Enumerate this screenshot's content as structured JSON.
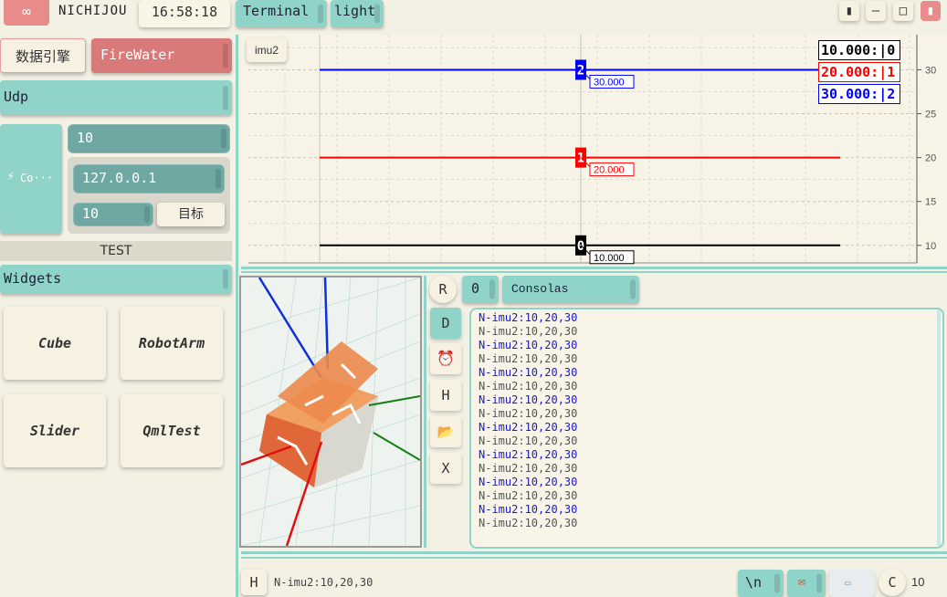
{
  "app": {
    "logo_symbol": "∞",
    "title": "NICHIJOU",
    "clock": "16:58:18",
    "tab_terminal": "Terminal",
    "tab_theme": "light",
    "window_controls": {
      "pin": "▮",
      "minimize": "–",
      "maximize": "□",
      "close": "▮"
    }
  },
  "left": {
    "engine_label": "数据引擎",
    "engine_value": "FireWater",
    "protocol": "Udp",
    "connect_label": "Co···",
    "interval": "10",
    "ip": "127.0.0.1",
    "port": "10",
    "target_label": "目标",
    "test_label": "TEST",
    "widgets_label": "Widgets",
    "tiles": [
      "Cube",
      "RobotArm",
      "Slider",
      "QmlTest"
    ]
  },
  "plot": {
    "tag": "imu2",
    "legend": [
      {
        "text": "10.000:|0",
        "color": "#000000"
      },
      {
        "text": "20.000:|1",
        "color": "#ff0000"
      },
      {
        "text": "30.000:|2",
        "color": "#0000ff"
      }
    ],
    "chart_data": {
      "type": "line",
      "x": [
        0,
        1
      ],
      "series": [
        {
          "values": [
            10,
            10
          ],
          "color": "#000000",
          "marker": "0",
          "label": "10.000"
        },
        {
          "values": [
            20,
            20
          ],
          "color": "#ff0000",
          "marker": "1",
          "label": "20.000"
        },
        {
          "values": [
            30,
            30
          ],
          "color": "#0000ff",
          "marker": "2",
          "label": "30.000"
        }
      ],
      "ylim": [
        8,
        34
      ],
      "yticks": [
        10,
        15,
        20,
        25,
        30
      ],
      "grid": true
    }
  },
  "terminal": {
    "btn_r": "R",
    "btn_d": "D",
    "btn_h": "H",
    "btn_x": "X",
    "mode_value": "0",
    "font_value": "Consolas",
    "lines": [
      {
        "text": "N-imu2:10,20,30",
        "color": "#1a1acc"
      },
      {
        "text": "N-imu2:10,20,30",
        "color": "#555555"
      },
      {
        "text": "N-imu2:10,20,30",
        "color": "#1a1acc"
      },
      {
        "text": "N-imu2:10,20,30",
        "color": "#555555"
      },
      {
        "text": "N-imu2:10,20,30",
        "color": "#1a1acc"
      },
      {
        "text": "N-imu2:10,20,30",
        "color": "#555555"
      },
      {
        "text": "N-imu2:10,20,30",
        "color": "#1a1acc"
      },
      {
        "text": "N-imu2:10,20,30",
        "color": "#555555"
      },
      {
        "text": "N-imu2:10,20,30",
        "color": "#1a1acc"
      },
      {
        "text": "N-imu2:10,20,30",
        "color": "#555555"
      },
      {
        "text": "N-imu2:10,20,30",
        "color": "#1a1acc"
      },
      {
        "text": "N-imu2:10,20,30",
        "color": "#555555"
      },
      {
        "text": "N-imu2:10,20,30",
        "color": "#1a1acc"
      },
      {
        "text": "N-imu2:10,20,30",
        "color": "#555555"
      },
      {
        "text": "N-imu2:10,20,30",
        "color": "#1a1acc"
      },
      {
        "text": "N-imu2:10,20,30",
        "color": "#555555"
      }
    ],
    "input_label": "H",
    "input_value": "N-imu2:10,20,30",
    "newline_label": "\\n",
    "clear_label": "C",
    "count": "10"
  }
}
